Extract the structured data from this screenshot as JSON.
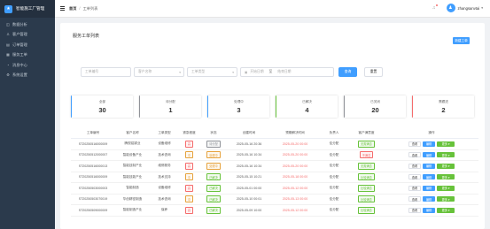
{
  "brand": {
    "title": "智能施工厂管理",
    "logo_glyph": "★"
  },
  "sidebar": {
    "items": [
      {
        "label": "数据分析",
        "icon": "chart-icon",
        "glyph": "◫"
      },
      {
        "label": "客户管理",
        "icon": "user-icon",
        "glyph": "♙"
      },
      {
        "label": "订单管理",
        "icon": "order-icon",
        "glyph": "▤"
      },
      {
        "label": "服务工单",
        "icon": "ticket-icon",
        "glyph": "▦"
      },
      {
        "label": "消息中心",
        "icon": "bell-icon",
        "glyph": "◔"
      },
      {
        "label": "系统设置",
        "icon": "gear-icon",
        "glyph": "⚙"
      }
    ]
  },
  "topbar": {
    "crumb1": "首页",
    "crumb_sep": "/",
    "crumb2": "工单列表",
    "avatar_glyph": "♟",
    "username": "zhangsanvtai",
    "caret": "▾"
  },
  "card": {
    "title": "服务工单列表",
    "create_label": "新建工单"
  },
  "filters": {
    "ticket_no_placeholder": "工单编号",
    "customer_placeholder": "客户名称",
    "type_placeholder": "工单类型",
    "start_placeholder": "开始日期",
    "range_sep": "至",
    "end_placeholder": "结束日期",
    "query_label": "查询",
    "reset_label": "重置"
  },
  "stats": [
    {
      "label": "全部",
      "value": "30",
      "color": "#409eff"
    },
    {
      "label": "待分配",
      "value": "1",
      "color": "#909399"
    },
    {
      "label": "处理中",
      "value": "3",
      "color": "#409eff"
    },
    {
      "label": "已解决",
      "value": "4",
      "color": "#67c23a"
    },
    {
      "label": "已关闭",
      "value": "20",
      "color": "#909399"
    },
    {
      "label": "需跟进",
      "value": "2",
      "color": "#f56c6c"
    }
  ],
  "table": {
    "headers": [
      "工单编号",
      "客户名称",
      "工单类型",
      "紧急程度",
      "状态",
      "创建时间",
      "预期解决时间",
      "负责人",
      "客户满意度",
      "操作"
    ],
    "rows": [
      [
        "ST20250516000009",
        "腾视铝锅业",
        "设备维修",
        "高",
        "待分配",
        "2025-05-16 20:36",
        "2025-05-20 00:00",
        "佳分配",
        "无需满意",
        ""
      ],
      [
        "ST20250512000007",
        "智能设备产业",
        "技术咨询",
        "中",
        "处理中",
        "2025-05-16 10:34",
        "2025-05-20 00:00",
        "佳分配",
        "不满意",
        ""
      ],
      [
        "ST20250516000013",
        "智能技制产业",
        "维修服务",
        "高",
        "处理中",
        "2025-05-16 10:34",
        "2025-05-20 00:00",
        "佳分配",
        "无需满意",
        ""
      ],
      [
        "ST20250516000009",
        "智能技能产业",
        "技术支持",
        "中",
        "已解决",
        "2025-05-15 10:21",
        "2025-05-18 00:00",
        "佳分配",
        "比较满意",
        ""
      ],
      [
        "ST20250503000003",
        "智能制造",
        "设备维修",
        "高",
        "已解决",
        "2025-05-01 00:00",
        "2025-05-12 00:00",
        "佳分配",
        "比较满意",
        ""
      ],
      [
        "ST20250503070019",
        "华创精密制造",
        "技术咨询",
        "中",
        "已解决",
        "2025-05-10 00:01",
        "2025-05-13 00:00",
        "佳分配",
        "比较满意",
        ""
      ],
      [
        "ST20250509000009",
        "智能制造产业",
        "保养",
        "高",
        "已解决",
        "2025-05-09 10:00",
        "2025-05-12 00:00",
        "佳分配",
        "比较满意",
        ""
      ]
    ],
    "urgency_colors": {
      "高": "#f56c6c",
      "中": "#e6a23c"
    },
    "status_colors": {
      "待分配": "#909399",
      "处理中": "#e6a23c",
      "已解决": "#67c23a"
    },
    "satisfaction_colors": {
      "无需满意": "#67c23a",
      "不满意": "#f56c6c",
      "比较满意": "#67c23a"
    },
    "due_overdue_color": "#f56c6c",
    "ops": {
      "view": "查看",
      "edit": "编辑",
      "more": "更多 ▾"
    }
  }
}
